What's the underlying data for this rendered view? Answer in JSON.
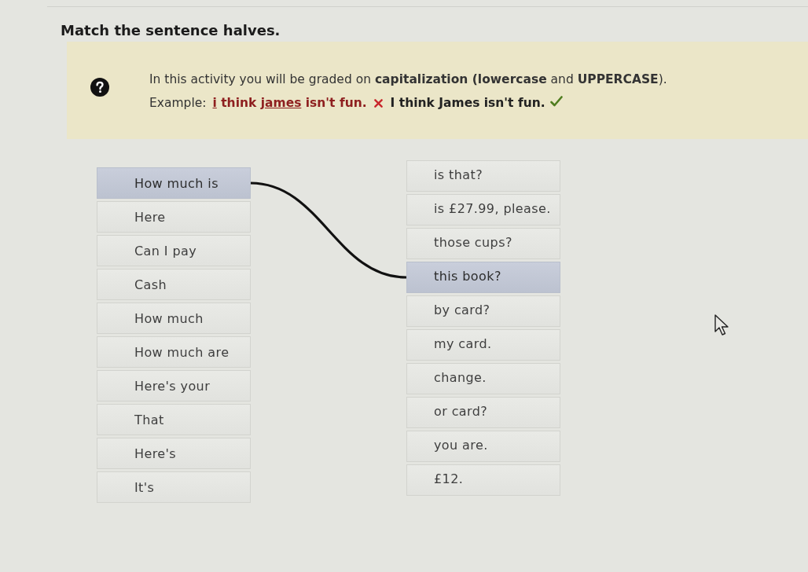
{
  "title": "Match the sentence halves.",
  "instructions": {
    "text": "In this activity you will be graded on **capitalization (lowercase** and **UPPERCASE**).",
    "example_label": "Example:",
    "examples": [
      {
        "kind": "incorrect",
        "parts": [
          {
            "text": "i",
            "underlined": true
          },
          {
            "text": " think ",
            "underlined": false
          },
          {
            "text": "james",
            "underlined": true
          },
          {
            "text": " isn't fun.",
            "underlined": false
          }
        ]
      },
      {
        "kind": "correct",
        "parts": [
          {
            "text": "I think James isn't fun.",
            "underlined": false
          }
        ]
      }
    ]
  },
  "left_items": [
    {
      "text": "How much is",
      "selected": true
    },
    {
      "text": "Here",
      "selected": false
    },
    {
      "text": "Can I pay",
      "selected": false
    },
    {
      "text": "Cash",
      "selected": false
    },
    {
      "text": "How much",
      "selected": false
    },
    {
      "text": "How much are",
      "selected": false
    },
    {
      "text": "Here's your",
      "selected": false
    },
    {
      "text": "That",
      "selected": false
    },
    {
      "text": "Here's",
      "selected": false
    },
    {
      "text": "It's",
      "selected": false
    }
  ],
  "right_items": [
    {
      "text": "is that?",
      "selected": false
    },
    {
      "text": "is £27.99, please.",
      "selected": false
    },
    {
      "text": "those cups?",
      "selected": false
    },
    {
      "text": "this book?",
      "selected": true
    },
    {
      "text": "by card?",
      "selected": false
    },
    {
      "text": "my card.",
      "selected": false
    },
    {
      "text": "change.",
      "selected": false
    },
    {
      "text": "or card?",
      "selected": false
    },
    {
      "text": "you are.",
      "selected": false
    },
    {
      "text": "£12.",
      "selected": false
    }
  ]
}
